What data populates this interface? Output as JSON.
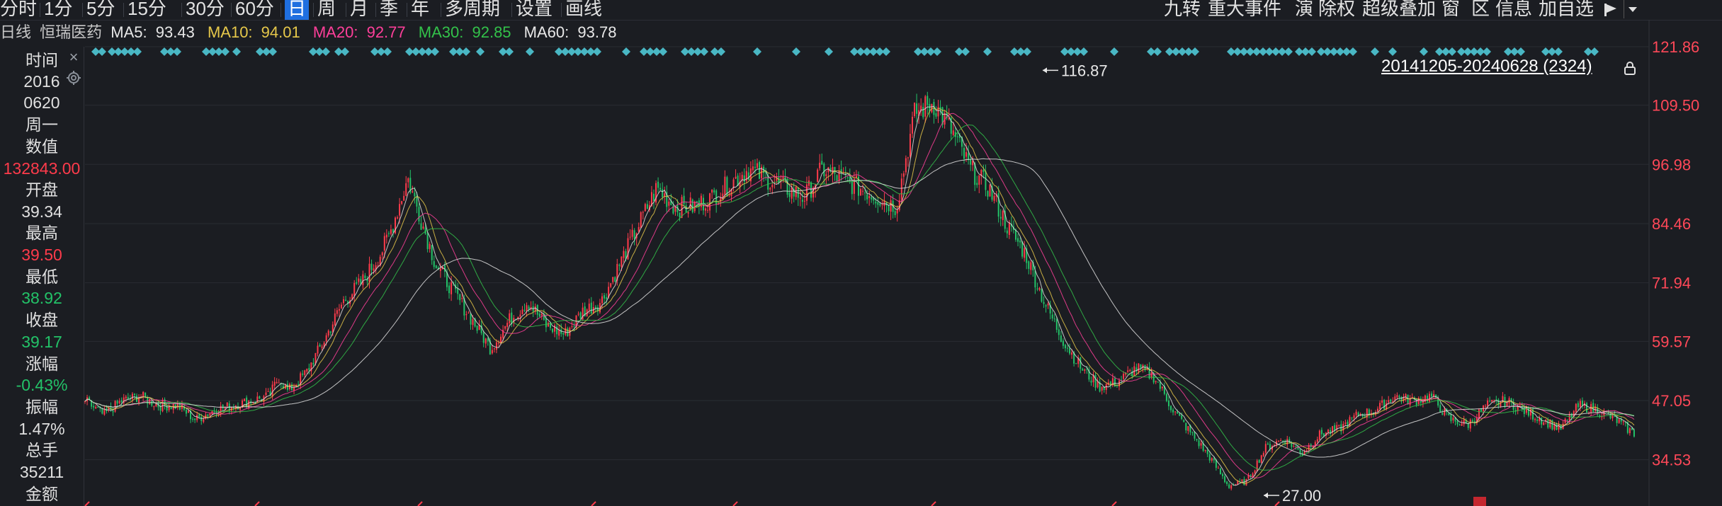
{
  "toolbar": {
    "periods": [
      "分时",
      "1分",
      "5分",
      "15分",
      "30分",
      "60分",
      "日",
      "周",
      "月",
      "季",
      "年",
      "多周期",
      "设置",
      "画线"
    ],
    "active_period": "日",
    "right_items": [
      "九转",
      "重大事件",
      "演",
      "除权",
      "超级叠加",
      "窗",
      "区",
      "信息",
      "加自选"
    ],
    "icons": [
      "flag-icon",
      "dropdown-arrow-icon"
    ]
  },
  "header": {
    "period_label": "日线",
    "stock_name": "恒瑞医药",
    "ma": [
      {
        "label": "MA5:",
        "value": "93.43",
        "color": "#e8e8e8"
      },
      {
        "label": "MA10:",
        "value": "94.01",
        "color": "#e6c84a"
      },
      {
        "label": "MA20:",
        "value": "92.77",
        "color": "#ff3f9a"
      },
      {
        "label": "MA30:",
        "value": "92.85",
        "color": "#33c24a"
      },
      {
        "label": "MA60:",
        "value": "93.78",
        "color": "#e8e8e8"
      }
    ]
  },
  "info_panel": {
    "time_label": "时间",
    "year": "2016",
    "date": "0620",
    "weekday": "周一",
    "value_label": "数值",
    "value": "132843.00",
    "open_label": "开盘",
    "open": "39.34",
    "high_label": "最高",
    "high": "39.50",
    "low_label": "最低",
    "low": "38.92",
    "close_label": "收盘",
    "close": "39.17",
    "change_label": "涨幅",
    "change": "-0.43%",
    "amplitude_label": "振幅",
    "amplitude": "1.47%",
    "volume_label": "总手",
    "volume": "35211",
    "amount_label": "金额"
  },
  "chart_data": {
    "type": "candlestick",
    "range_label": "20141205-20240628 (2324)",
    "y_ticks": [
      "121.86",
      "109.50",
      "96.98",
      "84.46",
      "71.94",
      "59.57",
      "47.05",
      "34.53"
    ],
    "ylim": [
      27.0,
      121.86
    ],
    "max_annotation": "116.87",
    "min_annotation": "27.00",
    "x_range": [
      "20141205",
      "20240628"
    ],
    "close_path": [
      [
        0,
        47
      ],
      [
        20,
        44
      ],
      [
        40,
        47
      ],
      [
        60,
        48
      ],
      [
        80,
        46
      ],
      [
        100,
        46
      ],
      [
        120,
        43
      ],
      [
        140,
        45
      ],
      [
        160,
        46
      ],
      [
        180,
        47
      ],
      [
        200,
        48
      ],
      [
        210,
        52
      ],
      [
        220,
        49
      ],
      [
        240,
        53
      ],
      [
        260,
        60
      ],
      [
        280,
        68
      ],
      [
        300,
        72
      ],
      [
        320,
        78
      ],
      [
        330,
        82
      ],
      [
        350,
        94
      ],
      [
        360,
        88
      ],
      [
        380,
        76
      ],
      [
        400,
        70
      ],
      [
        420,
        64
      ],
      [
        440,
        58
      ],
      [
        460,
        64
      ],
      [
        480,
        68
      ],
      [
        500,
        63
      ],
      [
        520,
        61
      ],
      [
        540,
        66
      ],
      [
        560,
        68
      ],
      [
        580,
        76
      ],
      [
        600,
        84
      ],
      [
        620,
        92
      ],
      [
        640,
        88
      ],
      [
        660,
        88
      ],
      [
        680,
        90
      ],
      [
        700,
        93
      ],
      [
        720,
        96
      ],
      [
        740,
        94
      ],
      [
        760,
        92
      ],
      [
        780,
        90
      ],
      [
        800,
        96
      ],
      [
        820,
        94
      ],
      [
        840,
        92
      ],
      [
        860,
        90
      ],
      [
        880,
        88
      ],
      [
        900,
        108
      ],
      [
        920,
        110
      ],
      [
        940,
        104
      ],
      [
        960,
        96
      ],
      [
        980,
        92
      ],
      [
        1000,
        84
      ],
      [
        1020,
        78
      ],
      [
        1040,
        68
      ],
      [
        1060,
        60
      ],
      [
        1080,
        54
      ],
      [
        1100,
        50
      ],
      [
        1120,
        51
      ],
      [
        1140,
        54
      ],
      [
        1160,
        52
      ],
      [
        1180,
        45
      ],
      [
        1200,
        40
      ],
      [
        1220,
        35
      ],
      [
        1240,
        29
      ],
      [
        1260,
        30
      ],
      [
        1280,
        37
      ],
      [
        1300,
        39
      ],
      [
        1320,
        36
      ],
      [
        1340,
        40
      ],
      [
        1360,
        41
      ],
      [
        1380,
        44
      ],
      [
        1400,
        45
      ],
      [
        1420,
        48
      ],
      [
        1440,
        47
      ],
      [
        1460,
        48
      ],
      [
        1480,
        43
      ],
      [
        1500,
        42
      ],
      [
        1520,
        46
      ],
      [
        1540,
        47
      ],
      [
        1560,
        45
      ],
      [
        1580,
        43
      ],
      [
        1600,
        41
      ],
      [
        1620,
        46
      ],
      [
        1640,
        45
      ],
      [
        1660,
        43
      ],
      [
        1680,
        40
      ]
    ],
    "colors": {
      "up": "#ff3b4b",
      "down": "#23c268",
      "ma_light": "#e0e0e0",
      "ma_yellow": "#e6c84a",
      "ma_pink": "#ff3f9a",
      "ma_green": "#33c24a"
    }
  }
}
